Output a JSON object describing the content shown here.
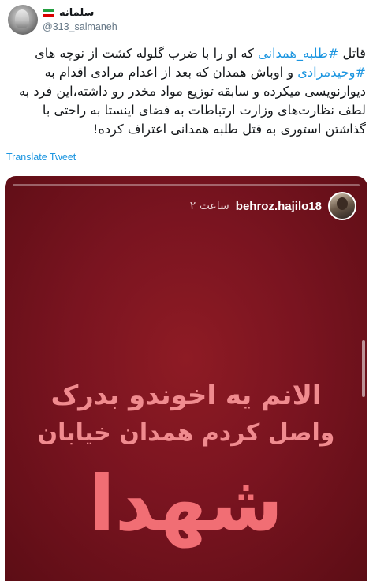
{
  "colors": {
    "link": "#1b95e0",
    "muted": "#657786",
    "overlay_text": "#f08b8f"
  },
  "author": {
    "display_name": "سلمانه",
    "handle": "@313_salmaneh",
    "flag_icon": "iran-flag-icon"
  },
  "tweet": {
    "segments": [
      {
        "type": "text",
        "text": "قاتل "
      },
      {
        "type": "hashtag",
        "text": "#طلبه_همدانی"
      },
      {
        "type": "text",
        "text": " که او را با ضرب گلوله کشت از نوچه های "
      },
      {
        "type": "hashtag",
        "text": "#وحیدمرادی"
      },
      {
        "type": "text",
        "text": " و اوباش همدان که بعد از اعدام مرادی اقدام به دیوارنویسی میکرده و سابقه توزیع مواد مخدر رو داشته،این فرد به لطف نظارت‌های وزارت ارتباطات به فضای اینستا به راحتی با گذاشتن استوری به قتل طلبه همدانی اعتراف کرده!"
      }
    ],
    "translate_label": "Translate Tweet"
  },
  "media": {
    "story_username": "behroz.hajilo18",
    "story_time": "۲ ساعت",
    "overlay_line1": "الانم یه اخوندو بدرک",
    "overlay_line2": "واصل کردم همدان خیابان",
    "big_word": "شهدا"
  }
}
